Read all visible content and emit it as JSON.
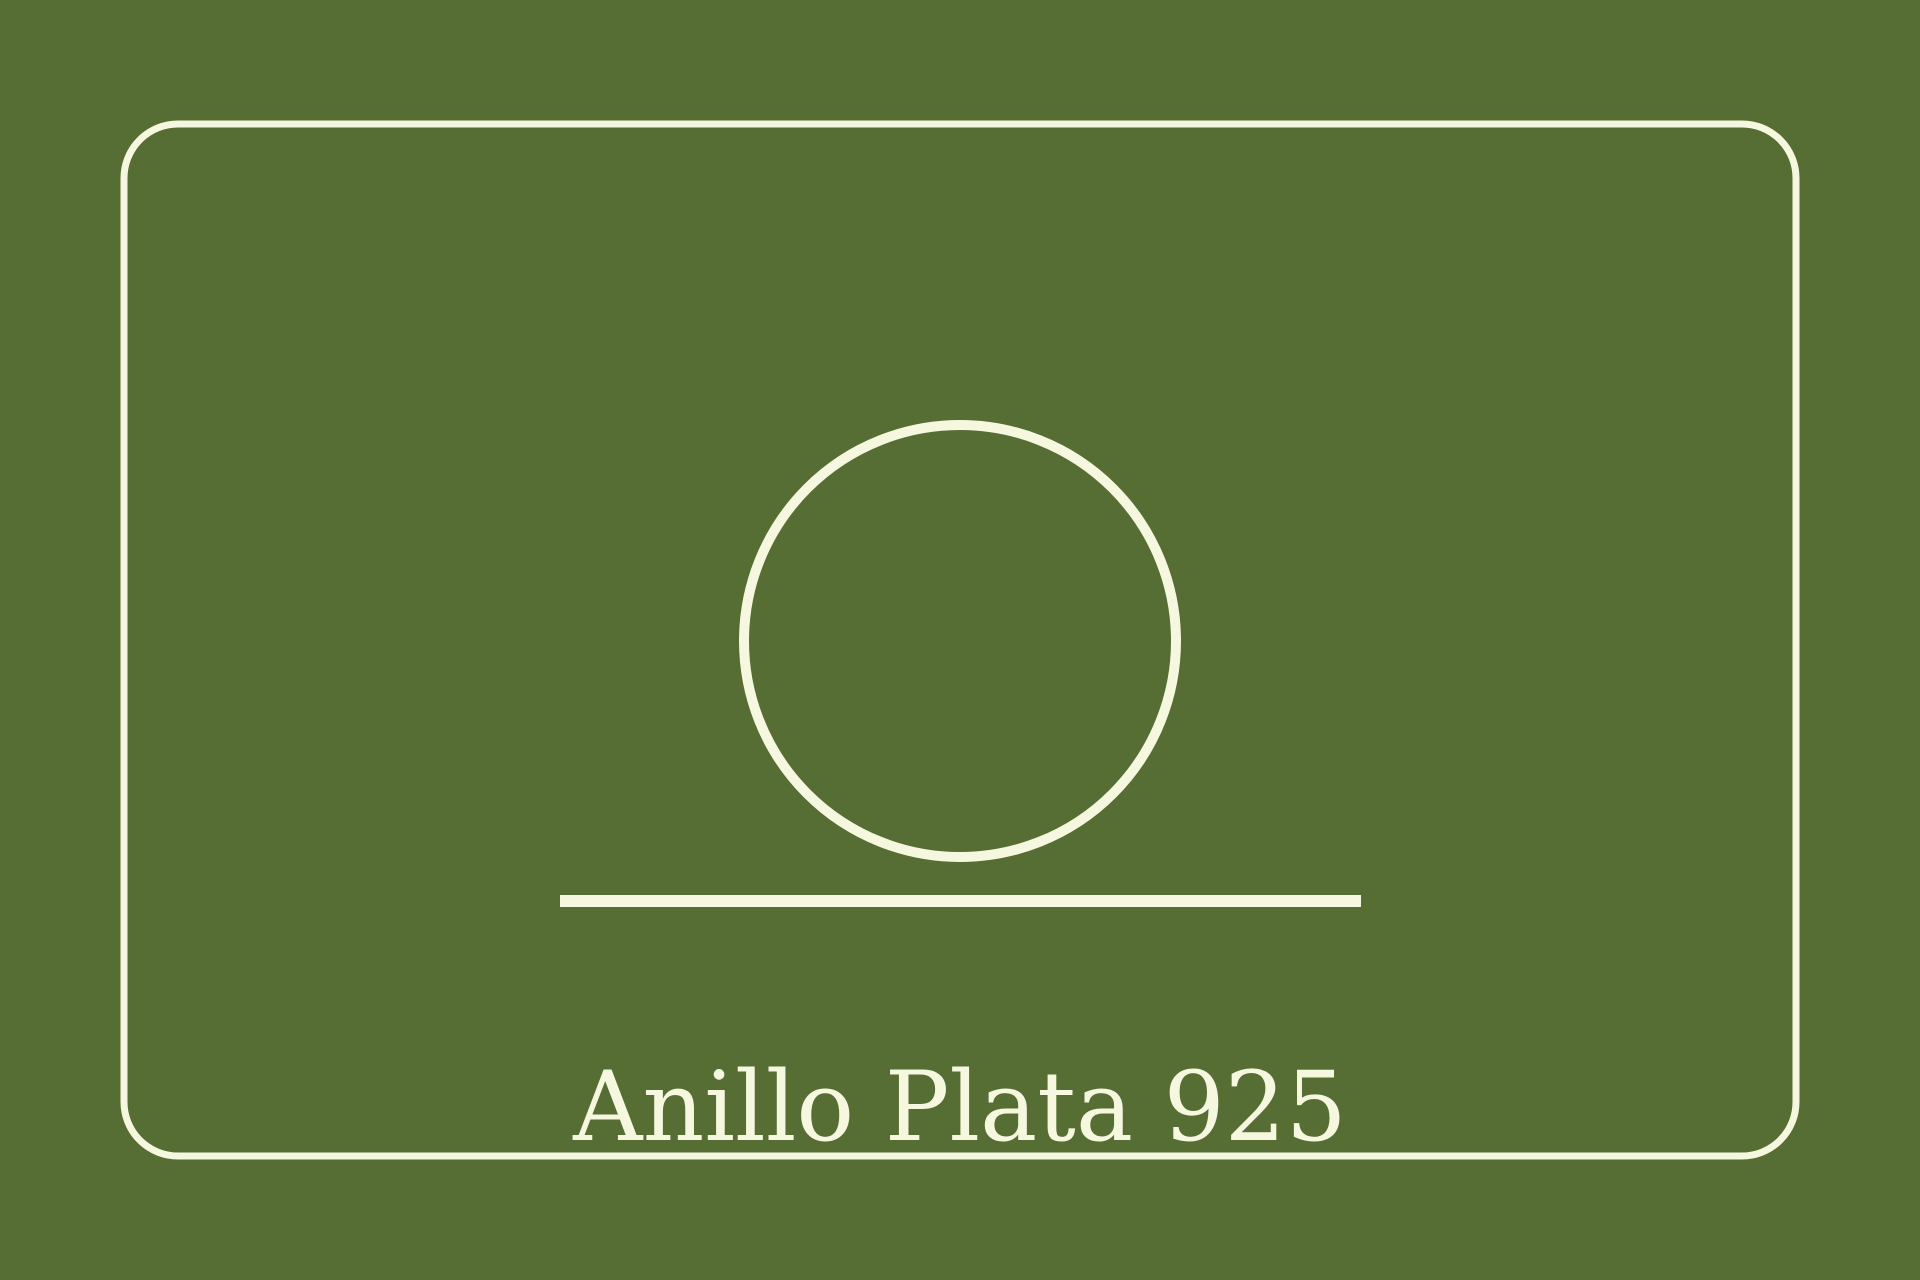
{
  "card": {
    "title": "Anillo Plata 925"
  },
  "icons": {
    "ring": "ring-icon"
  },
  "colors": {
    "background": "#566d33",
    "stroke": "#f6f7df",
    "text": "#f6f7df"
  }
}
